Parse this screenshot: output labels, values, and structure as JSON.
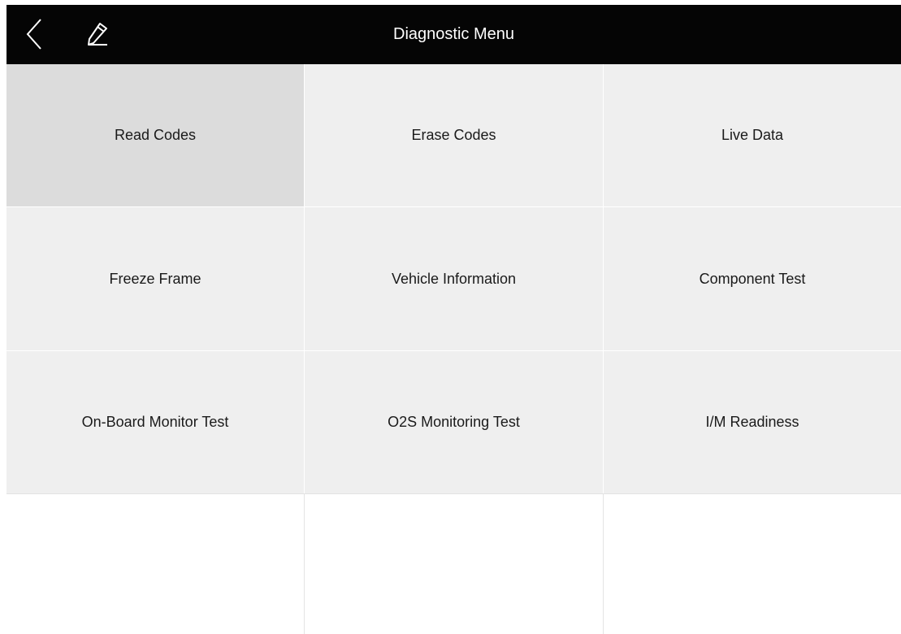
{
  "header": {
    "title": "Diagnostic Menu",
    "back_icon": "chevron-left-icon",
    "edit_icon": "pencil-icon",
    "background_color": "#050505"
  },
  "menu": {
    "items": [
      {
        "label": "Read Codes",
        "selected": true
      },
      {
        "label": "Erase Codes",
        "selected": false
      },
      {
        "label": "Live Data",
        "selected": false
      },
      {
        "label": "Freeze Frame",
        "selected": false
      },
      {
        "label": "Vehicle Information",
        "selected": false
      },
      {
        "label": "Component Test",
        "selected": false
      },
      {
        "label": "On-Board Monitor Test",
        "selected": false
      },
      {
        "label": "O2S Monitoring Test",
        "selected": false
      },
      {
        "label": "I/M Readiness",
        "selected": false
      }
    ],
    "cell_color": "#efefef",
    "selected_color": "#dcdcdc"
  }
}
